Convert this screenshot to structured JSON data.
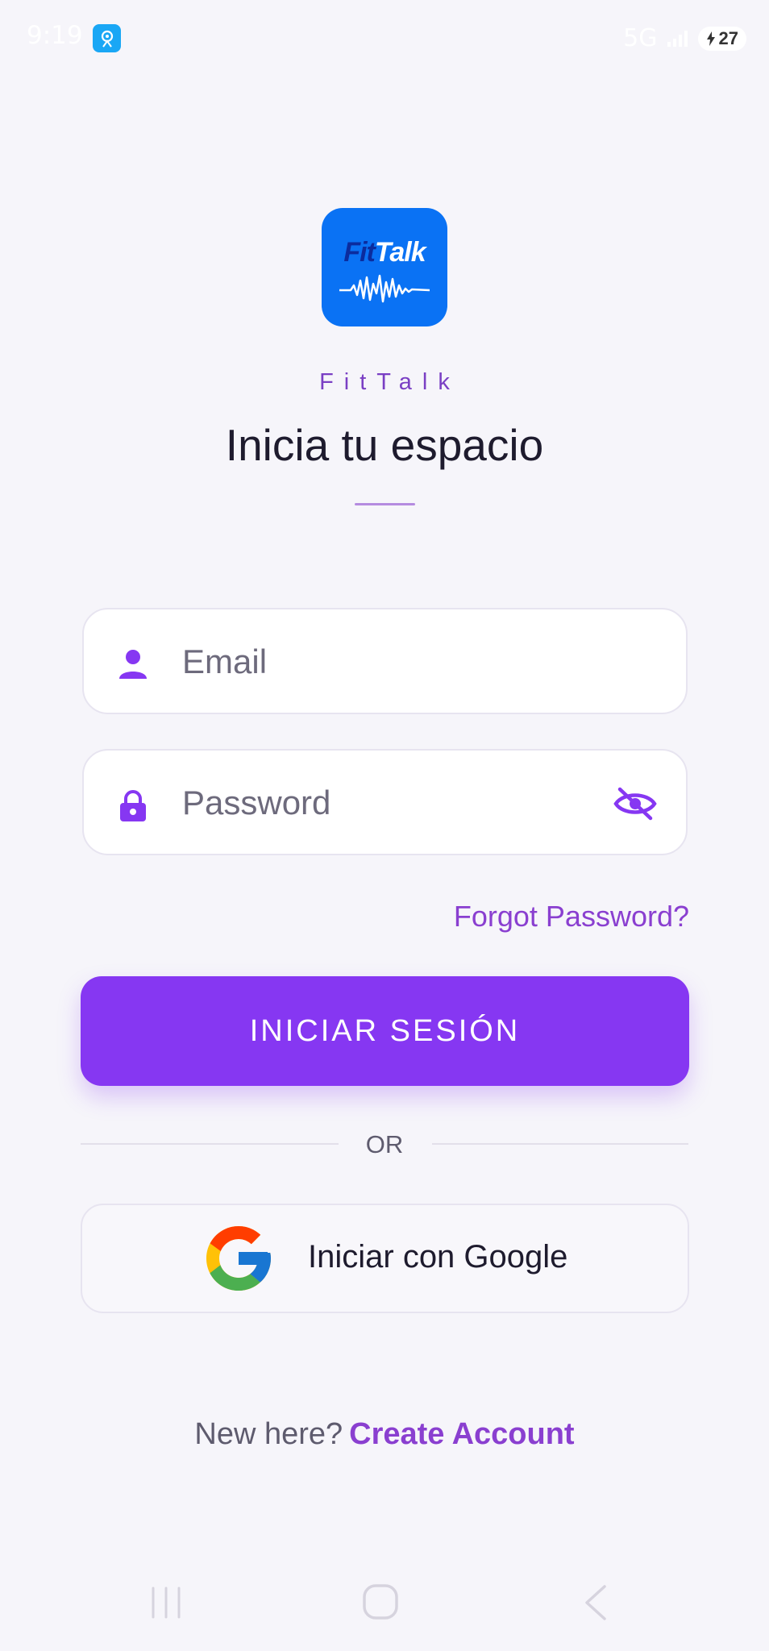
{
  "status_bar": {
    "time": "9:19",
    "network": "5G",
    "battery": "27"
  },
  "logo": {
    "text_fit": "Fit",
    "text_talk": "Talk"
  },
  "brand_name": "FitTalk",
  "headline": "Inicia tu espacio",
  "form": {
    "email_placeholder": "Email",
    "password_placeholder": "Password",
    "forgot_label": "Forgot Password?",
    "login_label": "INICIAR SESIÓN",
    "or_label": "OR",
    "google_label": "Iniciar con Google"
  },
  "signup": {
    "prompt": "New here?",
    "link": "Create Account"
  },
  "colors": {
    "accent": "#8637F2",
    "link": "#8A3FD0",
    "background": "#F6F5FA",
    "logo_blue": "#0A72F4"
  },
  "icons": [
    "person-icon",
    "lock-icon",
    "eye-off-icon",
    "google-icon",
    "recents-icon",
    "home-icon",
    "back-icon"
  ]
}
